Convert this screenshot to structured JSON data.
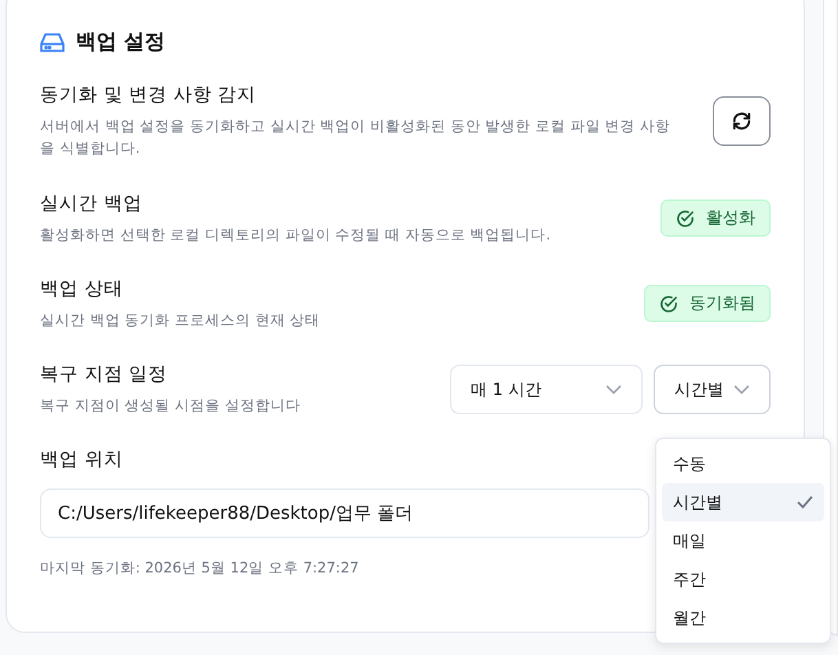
{
  "section": {
    "title": "백업 설정"
  },
  "rows": [
    {
      "kind": "button",
      "title": "동기화 및 변경 사항 감지",
      "description": "서버에서 백업 설정을 동기화하고 실시간 백업이 비활성화된 동안 발생한 로컬 파일 변경 사항을 식별합니다."
    },
    {
      "kind": "badge",
      "title": "실시간 백업",
      "description": "활성화하면 선택한 로컬 디렉토리의 파일이 수정될 때 자동으로 백업됩니다.",
      "badge": "활성화"
    },
    {
      "kind": "badge",
      "title": "백업 상태",
      "description": "실시간 백업 동기화 프로세스의 현재 상태",
      "badge": "동기화됨"
    },
    {
      "kind": "selects",
      "title": "복구 지점 일정",
      "description": "복구 지점이 생성될 시점을 설정합니다",
      "selects": [
        {
          "value": "매 1 시간",
          "expanded": false
        },
        {
          "value": "시간별",
          "expanded": true
        }
      ]
    }
  ],
  "location": {
    "title": "백업 위치",
    "value": "C:/Users/lifekeeper88/Desktop/업무 폴더",
    "last_sync": "마지막 동기화: 2026년 5월 12일 오후 7:27:27"
  },
  "dropdown": [
    {
      "label": "수동",
      "selected": false
    },
    {
      "label": "시간별",
      "selected": true
    },
    {
      "label": "매일",
      "selected": false
    },
    {
      "label": "주간",
      "selected": false
    },
    {
      "label": "월간",
      "selected": false
    }
  ]
}
